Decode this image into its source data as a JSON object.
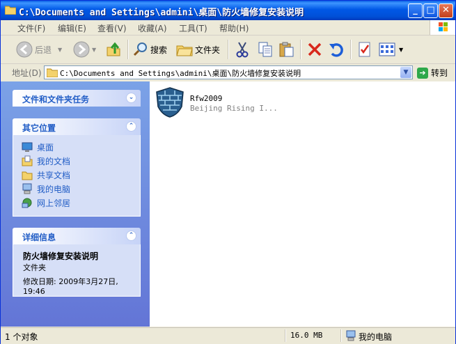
{
  "window": {
    "title": "C:\\Documents and Settings\\admini\\桌面\\防火墙修复安装说明",
    "minimize": "_",
    "maximize": "□",
    "close": "✕"
  },
  "menu": [
    "文件(F)",
    "编辑(E)",
    "查看(V)",
    "收藏(A)",
    "工具(T)",
    "帮助(H)"
  ],
  "toolbar": {
    "back": "后退",
    "search": "搜索",
    "folders": "文件夹"
  },
  "address": {
    "label": "地址(D)",
    "value": "C:\\Documents and Settings\\admini\\桌面\\防火墙修复安装说明",
    "go": "转到"
  },
  "sidebar": {
    "tasks_title": "文件和文件夹任务",
    "places_title": "其它位置",
    "places": [
      {
        "label": "桌面",
        "icon": "desktop-icon"
      },
      {
        "label": "我的文档",
        "icon": "my-documents-icon"
      },
      {
        "label": "共享文档",
        "icon": "shared-documents-icon"
      },
      {
        "label": "我的电脑",
        "icon": "my-computer-icon"
      },
      {
        "label": "网上邻居",
        "icon": "network-icon"
      }
    ],
    "details_title": "详细信息",
    "details_name": "防火墙修复安装说明",
    "details_type": "文件夹",
    "details_modified_line1": "修改日期: 2009年3月27日,",
    "details_modified_line2": "19:46"
  },
  "files": [
    {
      "name": "Rfw2009",
      "desc": "Beijing Rising I..."
    }
  ],
  "status": {
    "count": "1 个对象",
    "size": "16.0 MB",
    "location": "我的电脑"
  },
  "colors": {
    "title_blue": "#0054e3",
    "link_blue": "#215dc6",
    "sidebar_bg": "#7ba2e7"
  }
}
